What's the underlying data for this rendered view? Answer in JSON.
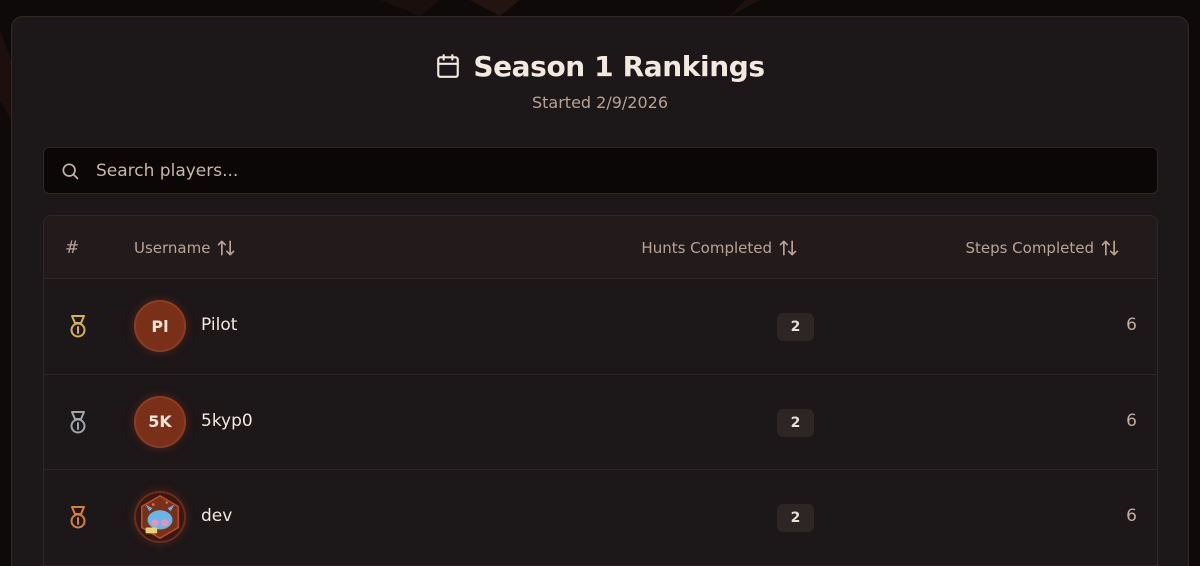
{
  "colors": {
    "gold": "#d9b33a",
    "silver": "#9ea6ae",
    "bronze": "#d9822b",
    "avatar_bg": "#7a2f18"
  },
  "header": {
    "icon": "calendar-icon",
    "title": "Season 1 Rankings",
    "subtitle": "Started 2/9/2026"
  },
  "search": {
    "placeholder": "Search players...",
    "value": "",
    "icon": "search-icon"
  },
  "table": {
    "columns": {
      "rank": "#",
      "username": "Username",
      "hunts": "Hunts Completed",
      "steps": "Steps Completed"
    },
    "rows": [
      {
        "medal": "gold-medal-icon",
        "avatar": "Pl",
        "username": "Pilot",
        "hunts": "2",
        "steps": "6"
      },
      {
        "medal": "silver-medal-icon",
        "avatar": "5K",
        "username": "5kyp0",
        "hunts": "2",
        "steps": "6"
      },
      {
        "medal": "bronze-medal-icon",
        "avatar": "",
        "username": "dev",
        "hunts": "2",
        "steps": "6"
      }
    ]
  }
}
